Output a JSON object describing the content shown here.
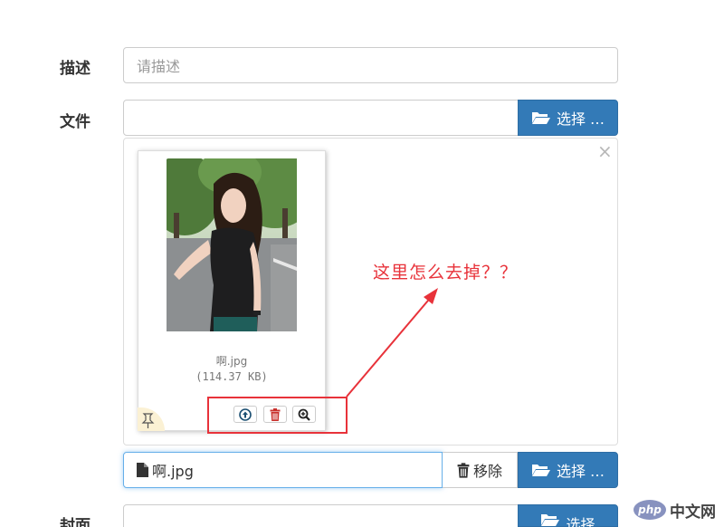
{
  "form": {
    "description": {
      "label": "描述",
      "placeholder": "请描述"
    },
    "file": {
      "label": "文件",
      "browse_label": "选择 …"
    },
    "cover": {
      "label": "封面",
      "browse_label": "选择"
    }
  },
  "preview": {
    "close_symbol": "×",
    "thumbnail": {
      "file_name": "啊.jpg",
      "file_size": "(114.37 KB)",
      "actions": [
        {
          "name": "upload",
          "icon": "upload-circle-icon"
        },
        {
          "name": "remove",
          "icon": "trash-icon"
        },
        {
          "name": "zoom",
          "icon": "zoom-in-icon"
        }
      ]
    }
  },
  "annotation": {
    "text": "这里怎么去掉？？",
    "color": "#e8323a"
  },
  "file_row": {
    "file_name": "啊.jpg",
    "remove_label": "移除",
    "browse_label": "选择 …"
  },
  "watermark": {
    "logo_text": "php",
    "site_text": "中文网"
  },
  "colors": {
    "primary": "#337ab7",
    "focus_border": "#66afe9",
    "annotation": "#e8323a"
  }
}
